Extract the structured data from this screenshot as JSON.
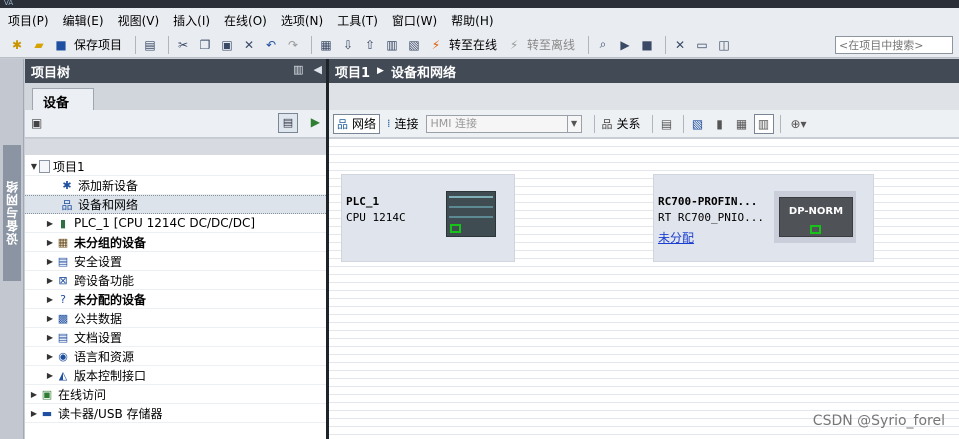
{
  "menu": [
    "项目(P)",
    "编辑(E)",
    "视图(V)",
    "插入(I)",
    "在线(O)",
    "选项(N)",
    "工具(T)",
    "窗口(W)",
    "帮助(H)"
  ],
  "toolbar": {
    "save_project": "保存项目",
    "go_online": "转至在线",
    "go_offline": "转至离线",
    "search_placeholder": "<在项目中搜索>"
  },
  "side_tab": "设备与网络",
  "project_tree": {
    "title": "项目树",
    "tab": "设备",
    "items": [
      {
        "label": "项目1",
        "level": 0,
        "expanded": true,
        "icon": "project-icon"
      },
      {
        "label": "添加新设备",
        "level": 1,
        "icon": "add-device-icon"
      },
      {
        "label": "设备和网络",
        "level": 1,
        "icon": "network-icon",
        "selected": true
      },
      {
        "label": "PLC_1 [CPU 1214C DC/DC/DC]",
        "level": 1,
        "icon": "plc-icon",
        "collapsed": true
      },
      {
        "label": "未分组的设备",
        "level": 1,
        "icon": "ungrouped-devices-icon",
        "collapsed": true,
        "bold": true
      },
      {
        "label": "安全设置",
        "level": 1,
        "icon": "security-icon",
        "collapsed": true
      },
      {
        "label": "跨设备功能",
        "level": 1,
        "icon": "cross-device-icon",
        "collapsed": true
      },
      {
        "label": "未分配的设备",
        "level": 1,
        "icon": "unassigned-devices-icon",
        "collapsed": true,
        "bold": true
      },
      {
        "label": "公共数据",
        "level": 1,
        "icon": "common-data-icon",
        "collapsed": true
      },
      {
        "label": "文档设置",
        "level": 1,
        "icon": "document-settings-icon",
        "collapsed": true
      },
      {
        "label": "语言和资源",
        "level": 1,
        "icon": "language-icon",
        "collapsed": true
      },
      {
        "label": "版本控制接口",
        "level": 1,
        "icon": "version-control-icon",
        "collapsed": true
      },
      {
        "label": "在线访问",
        "level": 0,
        "icon": "online-access-icon",
        "collapsed": true
      },
      {
        "label": "读卡器/USB 存储器",
        "level": 0,
        "icon": "card-reader-icon",
        "collapsed": true
      }
    ]
  },
  "breadcrumb": [
    "项目1",
    "设备和网络"
  ],
  "network_toolbar": {
    "network": "网络",
    "connection": "连接",
    "hmi_connection": "HMI 连接",
    "relation": "关系"
  },
  "devices": [
    {
      "name": "PLC_1",
      "type": "CPU 1214C"
    },
    {
      "name": "RC700-PROFIN...",
      "type": "RT  RC700_PNIO...",
      "link": "未分配",
      "module": "DP-NORM"
    }
  ],
  "watermark": "CSDN @Syrio_forel"
}
